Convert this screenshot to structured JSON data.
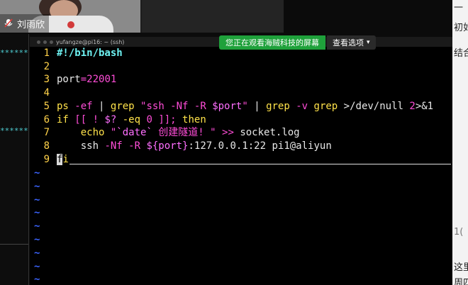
{
  "meeting": {
    "participant_name": "刘雨欣",
    "share_banner": "您正在观看海贼科技的屏幕",
    "view_options_label": "查看选项"
  },
  "terminal_title": "yufangze@pi16: ~ (ssh)",
  "left_pane": {
    "stars": [
      "******",
      "******"
    ]
  },
  "right_panel_text": [
    "一",
    "初如",
    "结合",
    "1(",
    "这里",
    "周四"
  ],
  "editor": {
    "lines": [
      {
        "n": "1",
        "parts": [
          {
            "t": "#!/bin/bash",
            "c": "c-comment"
          }
        ]
      },
      {
        "n": "2",
        "parts": []
      },
      {
        "n": "3",
        "parts": [
          {
            "t": "port",
            "c": "c-var"
          },
          {
            "t": "=",
            "c": "c-op"
          },
          {
            "t": "22001",
            "c": "c-num"
          }
        ]
      },
      {
        "n": "4",
        "parts": []
      },
      {
        "n": "5",
        "parts": [
          {
            "t": "ps ",
            "c": "c-kw"
          },
          {
            "t": "-ef",
            "c": "c-opt"
          },
          {
            "t": " | ",
            "c": "c-var"
          },
          {
            "t": "grep",
            "c": "c-kw"
          },
          {
            "t": " \"ssh -Nf -R ",
            "c": "c-str"
          },
          {
            "t": "$port",
            "c": "c-sub"
          },
          {
            "t": "\"",
            "c": "c-str"
          },
          {
            "t": " | ",
            "c": "c-var"
          },
          {
            "t": "grep",
            "c": "c-kw"
          },
          {
            "t": " -v ",
            "c": "c-opt"
          },
          {
            "t": "grep",
            "c": "c-kw"
          },
          {
            "t": " >/dev/null ",
            "c": "c-var"
          },
          {
            "t": "2",
            "c": "c-num"
          },
          {
            "t": ">&1",
            "c": "c-var"
          }
        ]
      },
      {
        "n": "6",
        "parts": [
          {
            "t": "if",
            "c": "c-kw"
          },
          {
            "t": " [[ ! ",
            "c": "c-op"
          },
          {
            "t": "$?",
            "c": "c-sub"
          },
          {
            "t": " -eq ",
            "c": "c-kw"
          },
          {
            "t": "0",
            "c": "c-num"
          },
          {
            "t": " ]]; ",
            "c": "c-op"
          },
          {
            "t": "then",
            "c": "c-kw"
          }
        ]
      },
      {
        "n": "7",
        "parts": [
          {
            "t": "    echo ",
            "c": "c-kw"
          },
          {
            "t": "\"",
            "c": "c-str"
          },
          {
            "t": "`date`",
            "c": "c-sub"
          },
          {
            "t": " 创建隧道! \"",
            "c": "c-str"
          },
          {
            "t": " >> ",
            "c": "c-op"
          },
          {
            "t": "socket.log",
            "c": "c-var"
          }
        ]
      },
      {
        "n": "8",
        "parts": [
          {
            "t": "    ssh ",
            "c": "c-var"
          },
          {
            "t": "-Nf -R ",
            "c": "c-opt"
          },
          {
            "t": "${port}",
            "c": "c-sub"
          },
          {
            "t": ":127.0.0.1:22 pi1@aliyun",
            "c": "c-var"
          }
        ]
      },
      {
        "n": "9",
        "parts": [
          {
            "t": "f",
            "c": "cursor"
          },
          {
            "t": "i",
            "c": "c-kw"
          }
        ]
      }
    ],
    "tilde": "~"
  }
}
